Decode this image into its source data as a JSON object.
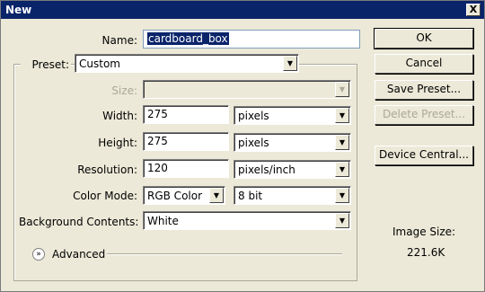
{
  "window": {
    "title": "New",
    "close_glyph": "X"
  },
  "name": {
    "label": "Name:",
    "value": "cardboard_box"
  },
  "preset": {
    "label": "Preset:",
    "value": "Custom"
  },
  "size": {
    "label": "Size:",
    "value": ""
  },
  "width": {
    "label": "Width:",
    "value": "275",
    "unit": "pixels"
  },
  "height": {
    "label": "Height:",
    "value": "275",
    "unit": "pixels"
  },
  "resolution": {
    "label": "Resolution:",
    "value": "120",
    "unit": "pixels/inch"
  },
  "color_mode": {
    "label": "Color Mode:",
    "value": "RGB Color",
    "depth": "8 bit"
  },
  "background": {
    "label": "Background Contents:",
    "value": "White"
  },
  "advanced": {
    "label": "Advanced"
  },
  "buttons": {
    "ok": "OK",
    "cancel": "Cancel",
    "save_preset": "Save Preset...",
    "delete_preset": "Delete Preset...",
    "device_central": "Device Central..."
  },
  "image_size": {
    "label": "Image Size:",
    "value": "221.6K"
  },
  "colors": {
    "titlebar": "#0a246a",
    "dialog_bg": "#ECE9D8",
    "disabled_text": "#aca899"
  }
}
